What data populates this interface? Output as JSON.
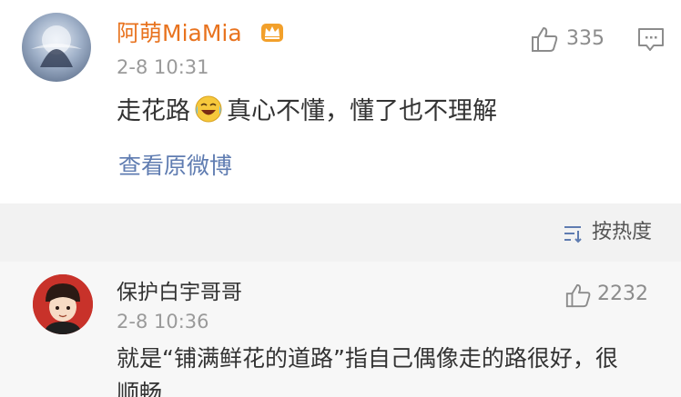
{
  "post": {
    "username": "阿萌MiaMia",
    "timestamp": "2-8 10:31",
    "like_count": "335",
    "text_before_emoji": "走花路",
    "emoji": "laughing-tears-emoji",
    "text_after_emoji": "真心不懂，懂了也不理解",
    "view_original_label": "查看原微博",
    "username_color": "#e8731f",
    "link_color": "#5f7cb1"
  },
  "sort_bar": {
    "label": "按热度",
    "icon": "sort-icon"
  },
  "reply": {
    "username": "保护白宇哥哥",
    "timestamp": "2-8 10:36",
    "like_count": "2232",
    "text": "就是“铺满鲜花的道路”指自己偶像走的路很好，很顺畅"
  }
}
